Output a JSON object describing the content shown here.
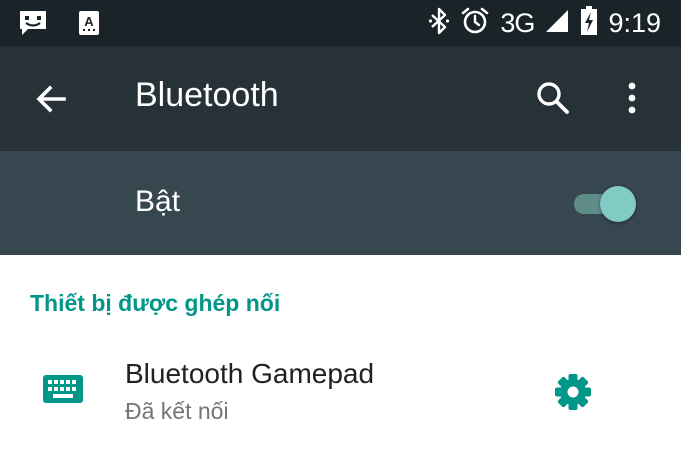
{
  "status_bar": {
    "left_icons": [
      "message-notification-icon",
      "keyboard-input-icon"
    ],
    "right_icons": [
      "bluetooth-icon",
      "alarm-icon",
      "signal-icon",
      "battery-charging-icon"
    ],
    "network": "3G",
    "time": "9:19"
  },
  "toolbar": {
    "title": "Bluetooth",
    "back_icon": "arrow-back-icon",
    "search_icon": "search-icon",
    "more_icon": "more-vert-icon"
  },
  "switch_bar": {
    "label": "Bật",
    "enabled": true
  },
  "paired_section": {
    "header": "Thiết bị được ghép nối",
    "devices": [
      {
        "name": "Bluetooth Gamepad",
        "status": "Đã kết nối",
        "icon": "keyboard-icon",
        "settings_icon": "gear-icon"
      }
    ]
  },
  "colors": {
    "status_bar_bg": "#1a2327",
    "toolbar_bg": "#263238",
    "switch_bar_bg": "#37474f",
    "accent": "#009688",
    "switch_thumb": "#80cbc4"
  }
}
